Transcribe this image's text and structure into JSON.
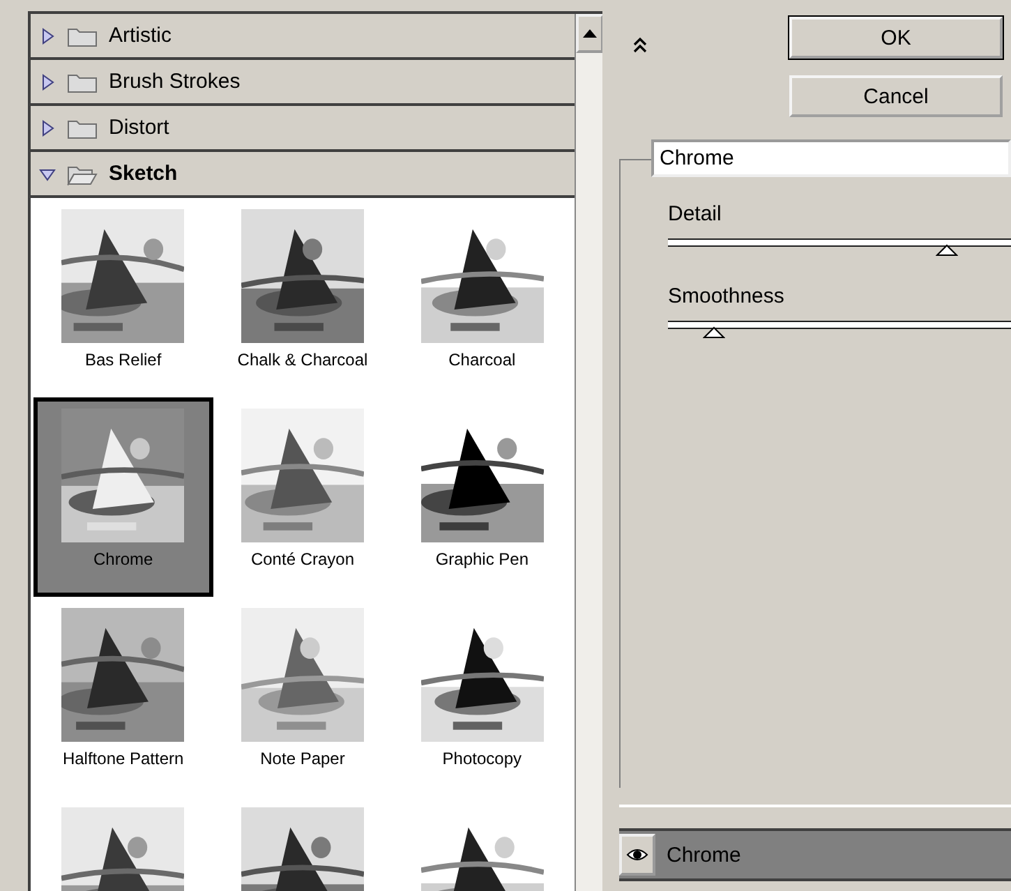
{
  "categories": [
    {
      "label": "Artistic",
      "expanded": false
    },
    {
      "label": "Brush Strokes",
      "expanded": false
    },
    {
      "label": "Distort",
      "expanded": false
    },
    {
      "label": "Sketch",
      "expanded": true
    }
  ],
  "filters": [
    {
      "name": "Bas Relief",
      "selected": false
    },
    {
      "name": "Chalk & Charcoal",
      "selected": false
    },
    {
      "name": "Charcoal",
      "selected": false
    },
    {
      "name": "Chrome",
      "selected": true
    },
    {
      "name": "Conté Crayon",
      "selected": false
    },
    {
      "name": "Graphic Pen",
      "selected": false
    },
    {
      "name": "Halftone Pattern",
      "selected": false
    },
    {
      "name": "Note Paper",
      "selected": false
    },
    {
      "name": "Photocopy",
      "selected": false
    },
    {
      "selected": false
    },
    {
      "selected": false
    },
    {
      "selected": false
    }
  ],
  "buttons": [
    "OK",
    "Cancel"
  ],
  "filter_select": {
    "value": "Chrome"
  },
  "sliders": [
    {
      "label": "Detail",
      "level": 0.78
    },
    {
      "label": "Smoothness",
      "level": 0.13
    }
  ],
  "layers": [
    {
      "name": "Chrome",
      "visible": true
    }
  ]
}
